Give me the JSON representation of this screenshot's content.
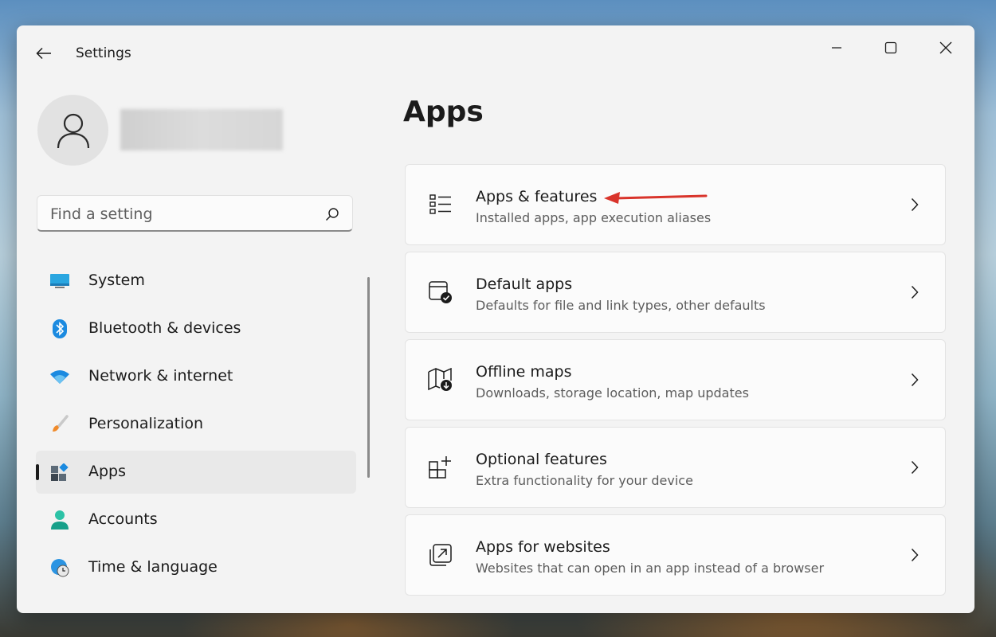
{
  "window": {
    "title": "Settings"
  },
  "search": {
    "placeholder": "Find a setting"
  },
  "sidebar": {
    "items": [
      {
        "label": "System",
        "icon": "monitor-icon"
      },
      {
        "label": "Bluetooth & devices",
        "icon": "bluetooth-icon"
      },
      {
        "label": "Network & internet",
        "icon": "wifi-icon"
      },
      {
        "label": "Personalization",
        "icon": "paintbrush-icon"
      },
      {
        "label": "Apps",
        "icon": "apps-icon",
        "selected": true
      },
      {
        "label": "Accounts",
        "icon": "person-icon"
      },
      {
        "label": "Time & language",
        "icon": "globe-clock-icon"
      }
    ]
  },
  "main": {
    "title": "Apps",
    "cards": [
      {
        "title": "Apps & features",
        "desc": "Installed apps, app execution aliases",
        "icon": "list-icon"
      },
      {
        "title": "Default apps",
        "desc": "Defaults for file and link types, other defaults",
        "icon": "default-apps-icon"
      },
      {
        "title": "Offline maps",
        "desc": "Downloads, storage location, map updates",
        "icon": "map-download-icon"
      },
      {
        "title": "Optional features",
        "desc": "Extra functionality for your device",
        "icon": "add-feature-icon"
      },
      {
        "title": "Apps for websites",
        "desc": "Websites that can open in an app instead of a browser",
        "icon": "open-external-icon"
      }
    ]
  },
  "colors": {
    "accent": "#0067c0",
    "annotation": "#d9342b",
    "window_bg": "#f3f3f3"
  }
}
